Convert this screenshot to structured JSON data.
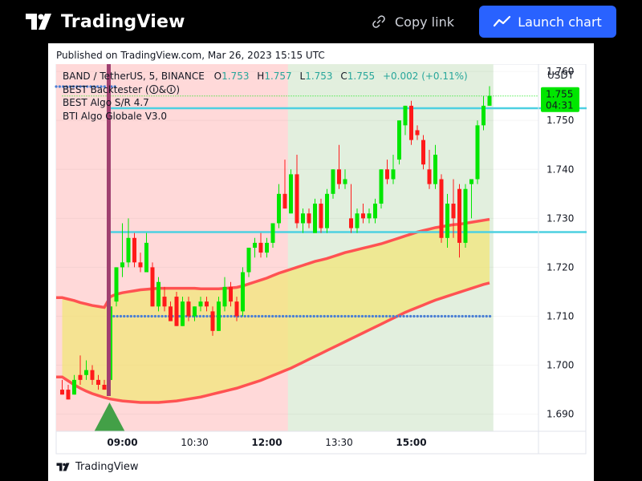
{
  "header": {
    "brand": "TradingView",
    "copy_link_label": "Copy link",
    "launch_chart_label": "Launch chart"
  },
  "published_text": "Published on TradingView.com, Mar 26, 2023 15:15 UTC",
  "footer_brand": "TradingView",
  "legend": {
    "symbol": "BAND / TetherUS, 5, BINANCE",
    "o_label": "O",
    "o_val": "1.753",
    "h_label": "H",
    "h_val": "1.757",
    "l_label": "L",
    "l_val": "1.753",
    "c_label": "C",
    "c_val": "1.755",
    "change": "+0.002 (+0.11%)",
    "indicators": [
      "BEST Backtester (🛈&🛈)",
      "BEST Algo S/R 4.7",
      "BTI Algo Globale V3.0"
    ]
  },
  "price_badge": {
    "price": "1.755",
    "countdown": "04:31"
  },
  "colors": {
    "up": "#00e600",
    "down": "#ff1a1a",
    "sr_line": "#4dd0e1",
    "band_line": "#ff5252",
    "band_fill": "#f2e67a",
    "bg_sell": "#ffd9d9",
    "bg_buy": "#e2efde",
    "dots": "#4a7fd4",
    "vline": "#a04070"
  },
  "chart_data": {
    "type": "candlestick",
    "symbol": "BAND / TetherUS",
    "timeframe": "5",
    "exchange": "BINANCE",
    "currency": "USDT",
    "ylim": [
      1.6865,
      1.7615
    ],
    "y_ticks": [
      "1.690",
      "1.700",
      "1.710",
      "1.720",
      "1.730",
      "1.740",
      "1.750",
      "1.760"
    ],
    "x_ticks": [
      {
        "i": 10,
        "label": "09:00",
        "bold": true
      },
      {
        "i": 22,
        "label": "10:30",
        "bold": false
      },
      {
        "i": 34,
        "label": "12:00",
        "bold": true
      },
      {
        "i": 46,
        "label": "13:30",
        "bold": false
      },
      {
        "i": 58,
        "label": "15:00",
        "bold": true
      }
    ],
    "last_price": 1.755,
    "resistance_level": 1.7525,
    "support_level": 1.7272,
    "dotted_level": 1.71,
    "candles": [
      {
        "o": 1.695,
        "h": 1.697,
        "l": 1.694,
        "c": 1.694
      },
      {
        "o": 1.695,
        "h": 1.696,
        "l": 1.693,
        "c": 1.693
      },
      {
        "o": 1.694,
        "h": 1.698,
        "l": 1.694,
        "c": 1.697
      },
      {
        "o": 1.698,
        "h": 1.702,
        "l": 1.696,
        "c": 1.697
      },
      {
        "o": 1.698,
        "h": 1.701,
        "l": 1.697,
        "c": 1.699
      },
      {
        "o": 1.699,
        "h": 1.7,
        "l": 1.696,
        "c": 1.697
      },
      {
        "o": 1.697,
        "h": 1.698,
        "l": 1.695,
        "c": 1.696
      },
      {
        "o": 1.696,
        "h": 1.697,
        "l": 1.695,
        "c": 1.695
      },
      {
        "o": 1.697,
        "h": 1.712,
        "l": 1.696,
        "c": 1.712
      },
      {
        "o": 1.713,
        "h": 1.72,
        "l": 1.712,
        "c": 1.72
      },
      {
        "o": 1.72,
        "h": 1.729,
        "l": 1.718,
        "c": 1.721
      },
      {
        "o": 1.721,
        "h": 1.73,
        "l": 1.72,
        "c": 1.726
      },
      {
        "o": 1.726,
        "h": 1.727,
        "l": 1.72,
        "c": 1.721
      },
      {
        "o": 1.721,
        "h": 1.723,
        "l": 1.719,
        "c": 1.72
      },
      {
        "o": 1.719,
        "h": 1.727,
        "l": 1.719,
        "c": 1.725
      },
      {
        "o": 1.72,
        "h": 1.721,
        "l": 1.712,
        "c": 1.712
      },
      {
        "o": 1.712,
        "h": 1.718,
        "l": 1.711,
        "c": 1.717
      },
      {
        "o": 1.714,
        "h": 1.716,
        "l": 1.711,
        "c": 1.712
      },
      {
        "o": 1.712,
        "h": 1.713,
        "l": 1.709,
        "c": 1.709
      },
      {
        "o": 1.714,
        "h": 1.715,
        "l": 1.708,
        "c": 1.708
      },
      {
        "o": 1.708,
        "h": 1.714,
        "l": 1.708,
        "c": 1.713
      },
      {
        "o": 1.713,
        "h": 1.714,
        "l": 1.709,
        "c": 1.71
      },
      {
        "o": 1.71,
        "h": 1.712,
        "l": 1.709,
        "c": 1.712
      },
      {
        "o": 1.712,
        "h": 1.714,
        "l": 1.711,
        "c": 1.713
      },
      {
        "o": 1.713,
        "h": 1.714,
        "l": 1.711,
        "c": 1.712
      },
      {
        "o": 1.711,
        "h": 1.712,
        "l": 1.706,
        "c": 1.707
      },
      {
        "o": 1.707,
        "h": 1.714,
        "l": 1.707,
        "c": 1.713
      },
      {
        "o": 1.712,
        "h": 1.718,
        "l": 1.711,
        "c": 1.716
      },
      {
        "o": 1.716,
        "h": 1.717,
        "l": 1.712,
        "c": 1.713
      },
      {
        "o": 1.713,
        "h": 1.714,
        "l": 1.709,
        "c": 1.71
      },
      {
        "o": 1.711,
        "h": 1.72,
        "l": 1.71,
        "c": 1.719
      },
      {
        "o": 1.719,
        "h": 1.724,
        "l": 1.718,
        "c": 1.724
      },
      {
        "o": 1.724,
        "h": 1.726,
        "l": 1.722,
        "c": 1.725
      },
      {
        "o": 1.725,
        "h": 1.727,
        "l": 1.722,
        "c": 1.723
      },
      {
        "o": 1.723,
        "h": 1.726,
        "l": 1.722,
        "c": 1.725
      },
      {
        "o": 1.725,
        "h": 1.729,
        "l": 1.724,
        "c": 1.729
      },
      {
        "o": 1.729,
        "h": 1.737,
        "l": 1.728,
        "c": 1.735
      },
      {
        "o": 1.735,
        "h": 1.742,
        "l": 1.732,
        "c": 1.732
      },
      {
        "o": 1.731,
        "h": 1.74,
        "l": 1.731,
        "c": 1.739
      },
      {
        "o": 1.739,
        "h": 1.743,
        "l": 1.728,
        "c": 1.729
      },
      {
        "o": 1.729,
        "h": 1.732,
        "l": 1.727,
        "c": 1.731
      },
      {
        "o": 1.731,
        "h": 1.732,
        "l": 1.728,
        "c": 1.729
      },
      {
        "o": 1.727,
        "h": 1.734,
        "l": 1.727,
        "c": 1.733
      },
      {
        "o": 1.733,
        "h": 1.734,
        "l": 1.727,
        "c": 1.728
      },
      {
        "o": 1.728,
        "h": 1.736,
        "l": 1.727,
        "c": 1.735
      },
      {
        "o": 1.735,
        "h": 1.74,
        "l": 1.734,
        "c": 1.74
      },
      {
        "o": 1.74,
        "h": 1.745,
        "l": 1.736,
        "c": 1.737
      },
      {
        "o": 1.737,
        "h": 1.74,
        "l": 1.736,
        "c": 1.738
      },
      {
        "o": 1.73,
        "h": 1.737,
        "l": 1.727,
        "c": 1.728
      },
      {
        "o": 1.728,
        "h": 1.732,
        "l": 1.727,
        "c": 1.731
      },
      {
        "o": 1.731,
        "h": 1.733,
        "l": 1.729,
        "c": 1.73
      },
      {
        "o": 1.73,
        "h": 1.732,
        "l": 1.729,
        "c": 1.731
      },
      {
        "o": 1.73,
        "h": 1.734,
        "l": 1.729,
        "c": 1.733
      },
      {
        "o": 1.733,
        "h": 1.74,
        "l": 1.732,
        "c": 1.74
      },
      {
        "o": 1.74,
        "h": 1.742,
        "l": 1.737,
        "c": 1.738
      },
      {
        "o": 1.738,
        "h": 1.743,
        "l": 1.737,
        "c": 1.74
      },
      {
        "o": 1.742,
        "h": 1.75,
        "l": 1.741,
        "c": 1.75
      },
      {
        "o": 1.749,
        "h": 1.753,
        "l": 1.747,
        "c": 1.753
      },
      {
        "o": 1.753,
        "h": 1.754,
        "l": 1.745,
        "c": 1.746
      },
      {
        "o": 1.748,
        "h": 1.749,
        "l": 1.746,
        "c": 1.747
      },
      {
        "o": 1.746,
        "h": 1.747,
        "l": 1.74,
        "c": 1.741
      },
      {
        "o": 1.74,
        "h": 1.744,
        "l": 1.736,
        "c": 1.737
      },
      {
        "o": 1.737,
        "h": 1.745,
        "l": 1.736,
        "c": 1.743
      },
      {
        "o": 1.738,
        "h": 1.739,
        "l": 1.725,
        "c": 1.726
      },
      {
        "o": 1.726,
        "h": 1.735,
        "l": 1.724,
        "c": 1.733
      },
      {
        "o": 1.733,
        "h": 1.738,
        "l": 1.726,
        "c": 1.73
      },
      {
        "o": 1.736,
        "h": 1.737,
        "l": 1.722,
        "c": 1.725
      },
      {
        "o": 1.725,
        "h": 1.737,
        "l": 1.724,
        "c": 1.736
      },
      {
        "o": 1.737,
        "h": 1.738,
        "l": 1.73,
        "c": 1.738
      },
      {
        "o": 1.738,
        "h": 1.75,
        "l": 1.737,
        "c": 1.749
      },
      {
        "o": 1.749,
        "h": 1.755,
        "l": 1.748,
        "c": 1.753
      },
      {
        "o": 1.753,
        "h": 1.757,
        "l": 1.753,
        "c": 1.755
      }
    ],
    "band_upper": [
      1.7138,
      1.7135,
      1.7132,
      1.7128,
      1.7125,
      1.7122,
      1.712,
      1.7118,
      1.714,
      1.7145,
      1.7148,
      1.715,
      1.7152,
      1.7154,
      1.7155,
      1.7156,
      1.7157,
      1.7157,
      1.7157,
      1.7157,
      1.7157,
      1.7157,
      1.7157,
      1.7156,
      1.7156,
      1.7156,
      1.7156,
      1.7157,
      1.7158,
      1.7159,
      1.7162,
      1.7166,
      1.717,
      1.7174,
      1.7178,
      1.7183,
      1.7188,
      1.7192,
      1.7196,
      1.72,
      1.7204,
      1.7208,
      1.7212,
      1.7215,
      1.7218,
      1.7222,
      1.7226,
      1.723,
      1.7233,
      1.7236,
      1.7239,
      1.7242,
      1.7245,
      1.7248,
      1.7252,
      1.7256,
      1.726,
      1.7264,
      1.7268,
      1.7272,
      1.7275,
      1.7278,
      1.7281,
      1.7283,
      1.7285,
      1.7287,
      1.7288,
      1.729,
      1.7292,
      1.7294,
      1.7296,
      1.7298
    ],
    "band_lower": [
      1.6976,
      1.6968,
      1.696,
      1.6953,
      1.6947,
      1.6942,
      1.6938,
      1.6934,
      1.6931,
      1.6929,
      1.6927,
      1.6926,
      1.6925,
      1.6924,
      1.6924,
      1.6924,
      1.6924,
      1.6925,
      1.6926,
      1.6927,
      1.6929,
      1.6931,
      1.6933,
      1.6935,
      1.6938,
      1.6941,
      1.6944,
      1.6947,
      1.695,
      1.6953,
      1.6957,
      1.6961,
      1.6965,
      1.6969,
      1.6974,
      1.6979,
      1.6984,
      1.6989,
      1.6994,
      1.7,
      1.7006,
      1.7012,
      1.7018,
      1.7024,
      1.703,
      1.7036,
      1.7042,
      1.7048,
      1.7054,
      1.706,
      1.7066,
      1.7072,
      1.7078,
      1.7084,
      1.709,
      1.7096,
      1.7102,
      1.7108,
      1.7113,
      1.7118,
      1.7123,
      1.7128,
      1.7133,
      1.7137,
      1.7141,
      1.7145,
      1.7149,
      1.7153,
      1.7157,
      1.7161,
      1.7165,
      1.7168
    ],
    "bg_zones": [
      {
        "from": 0,
        "to": 38,
        "color": "sell"
      },
      {
        "from": 38,
        "to": 72,
        "color": "buy"
      }
    ],
    "signal_index": 8
  }
}
